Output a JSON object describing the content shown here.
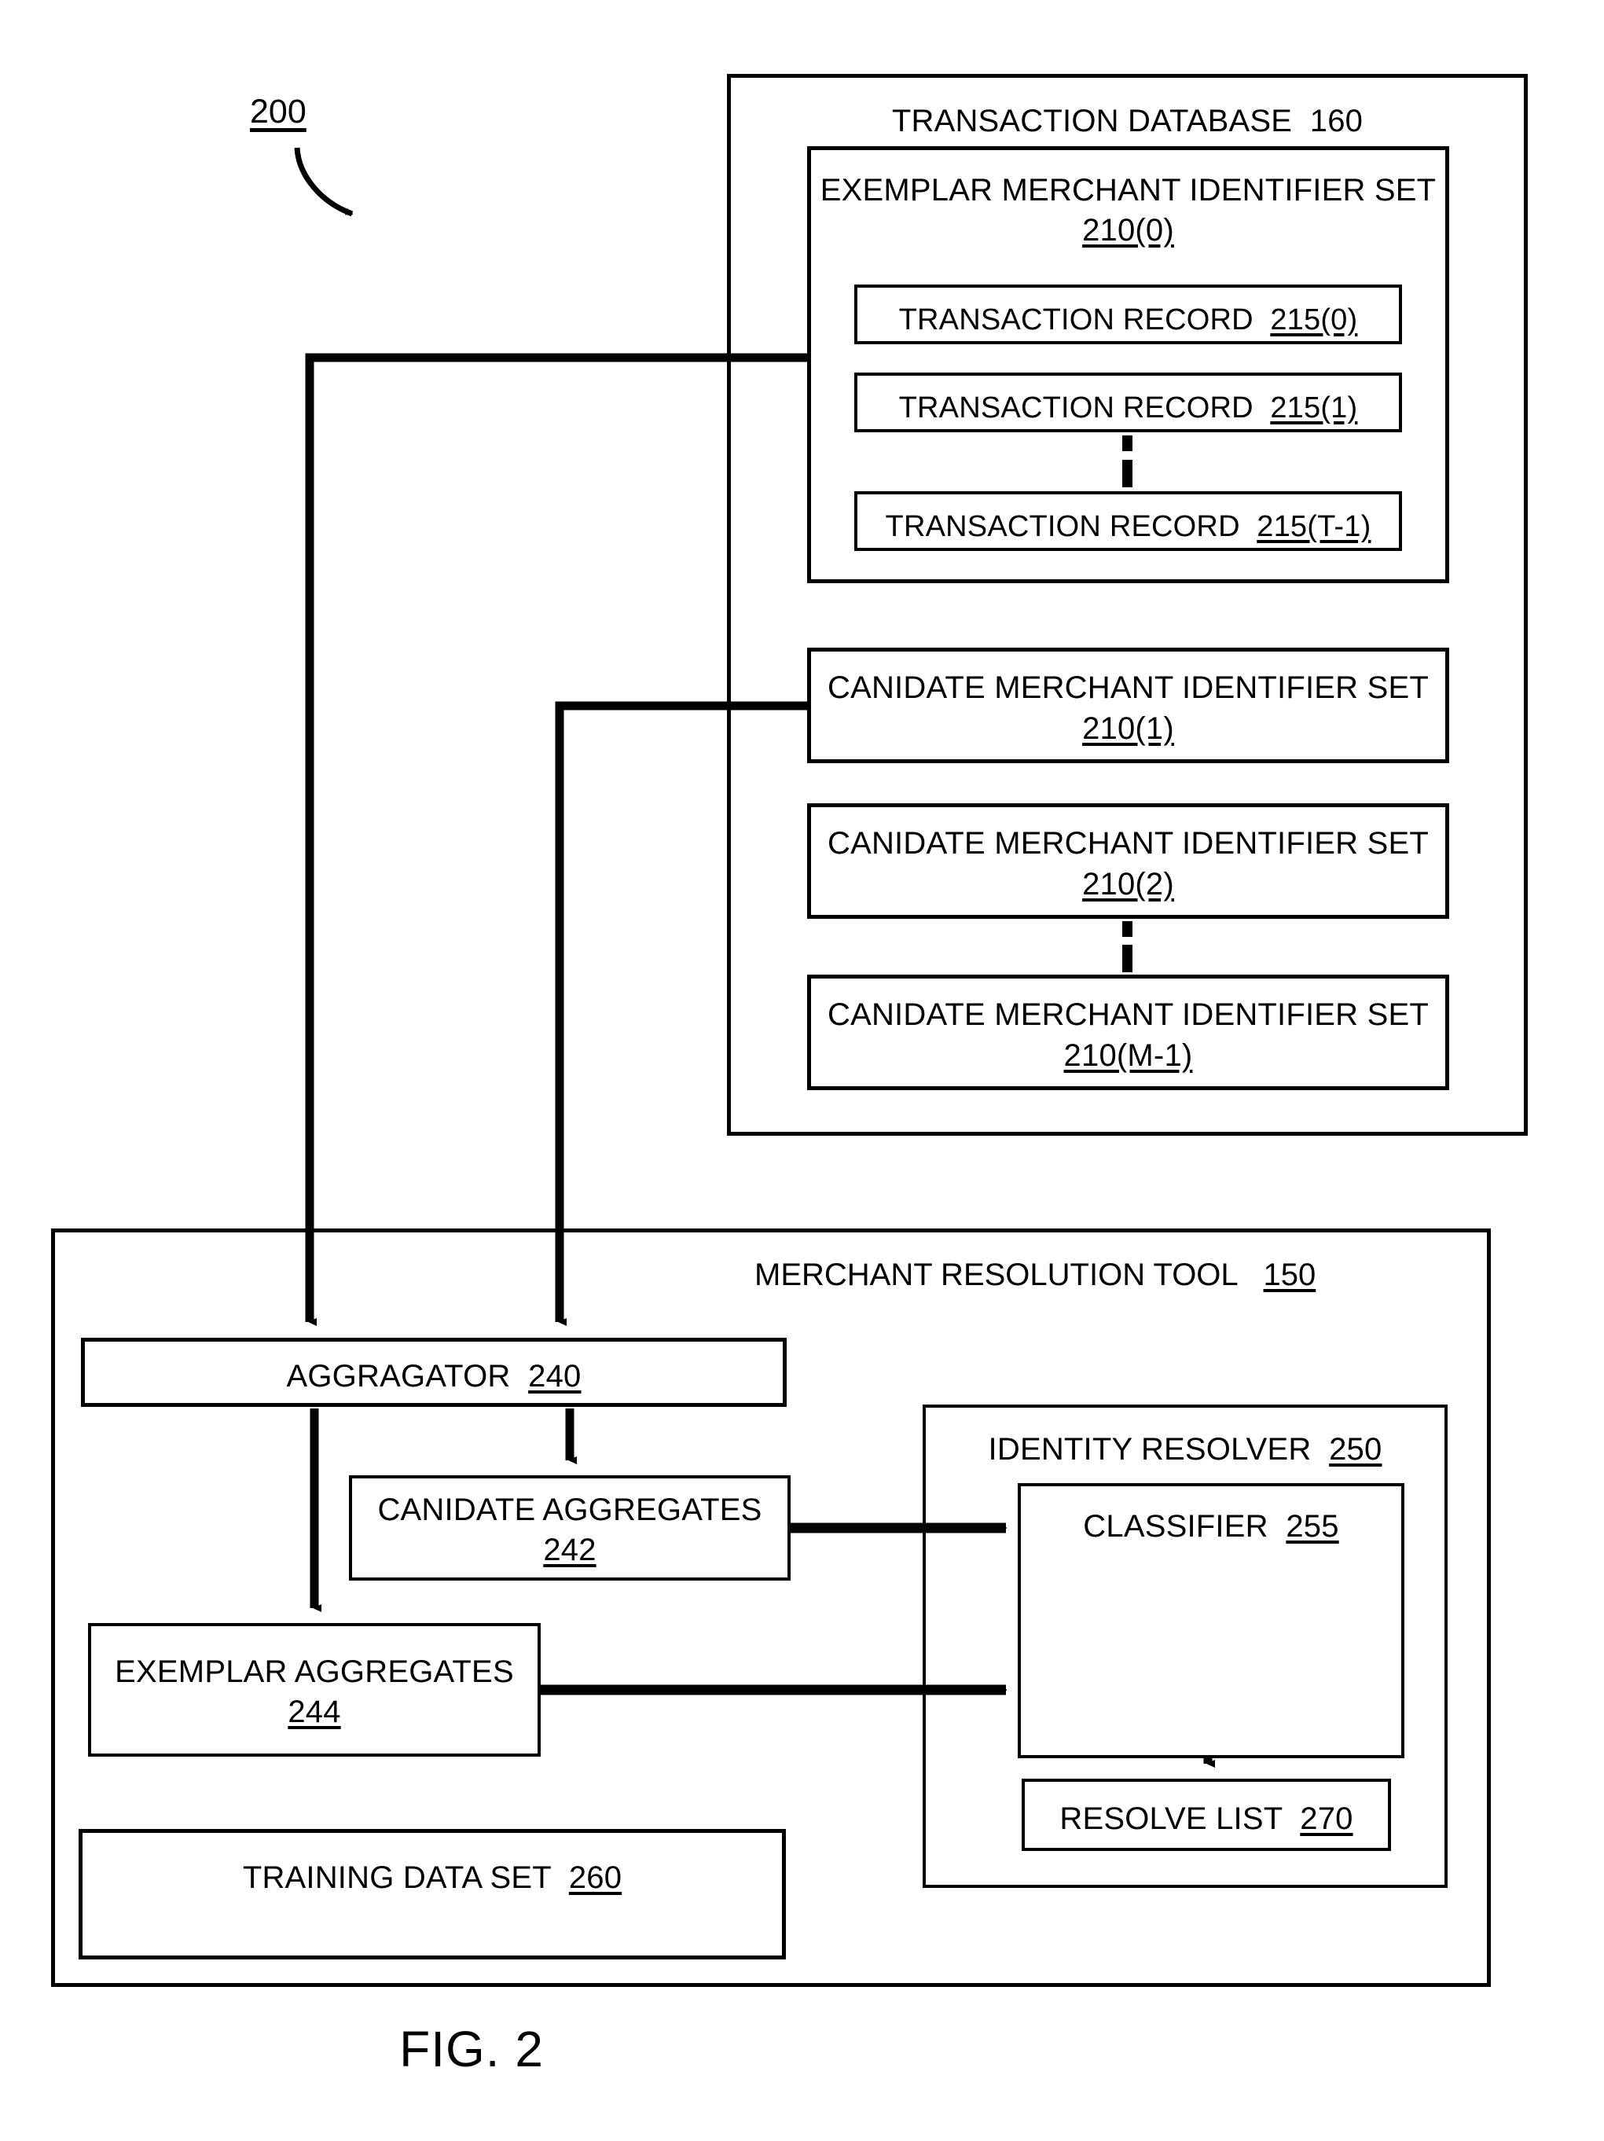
{
  "figure": {
    "reference_numeral": "200",
    "caption": "FIG. 2"
  },
  "transaction_database": {
    "title_text": "TRANSACTION DATABASE",
    "title_num": "160",
    "exemplar_set": {
      "title_text": "EXEMPLAR MERCHANT IDENTIFIER SET",
      "title_num": "210(0)",
      "records": [
        {
          "text": "TRANSACTION RECORD",
          "num": "215(0)"
        },
        {
          "text": "TRANSACTION RECORD",
          "num": "215(1)"
        },
        {
          "text": "TRANSACTION RECORD",
          "num": "215(T-1)"
        }
      ],
      "ellipsis": "vertical-dots"
    },
    "candidate_sets": [
      {
        "text": "CANIDATE MERCHANT IDENTIFIER SET",
        "num": "210(1)"
      },
      {
        "text": "CANIDATE MERCHANT IDENTIFIER SET",
        "num": "210(2)"
      },
      {
        "text": "CANIDATE MERCHANT IDENTIFIER SET",
        "num": "210(M-1)"
      }
    ],
    "candidate_ellipsis": "vertical-dots"
  },
  "merchant_resolution_tool": {
    "title_text": "MERCHANT RESOLUTION TOOL",
    "title_num": "150",
    "aggregator": {
      "text": "AGGRAGATOR",
      "num": "240"
    },
    "candidate_aggregates": {
      "text": "CANIDATE AGGREGATES",
      "num": "242"
    },
    "exemplar_aggregates": {
      "text": "EXEMPLAR AGGREGATES",
      "num": "244"
    },
    "training_data_set": {
      "text": "TRAINING DATA SET",
      "num": "260"
    },
    "identity_resolver": {
      "title_text": "IDENTITY RESOLVER",
      "title_num": "250",
      "classifier": {
        "text": "CLASSIFIER",
        "num": "255"
      },
      "resolve_list": {
        "text": "RESOLVE LIST",
        "num": "270"
      }
    }
  },
  "colors": {
    "stroke": "#000000",
    "background": "#ffffff"
  }
}
